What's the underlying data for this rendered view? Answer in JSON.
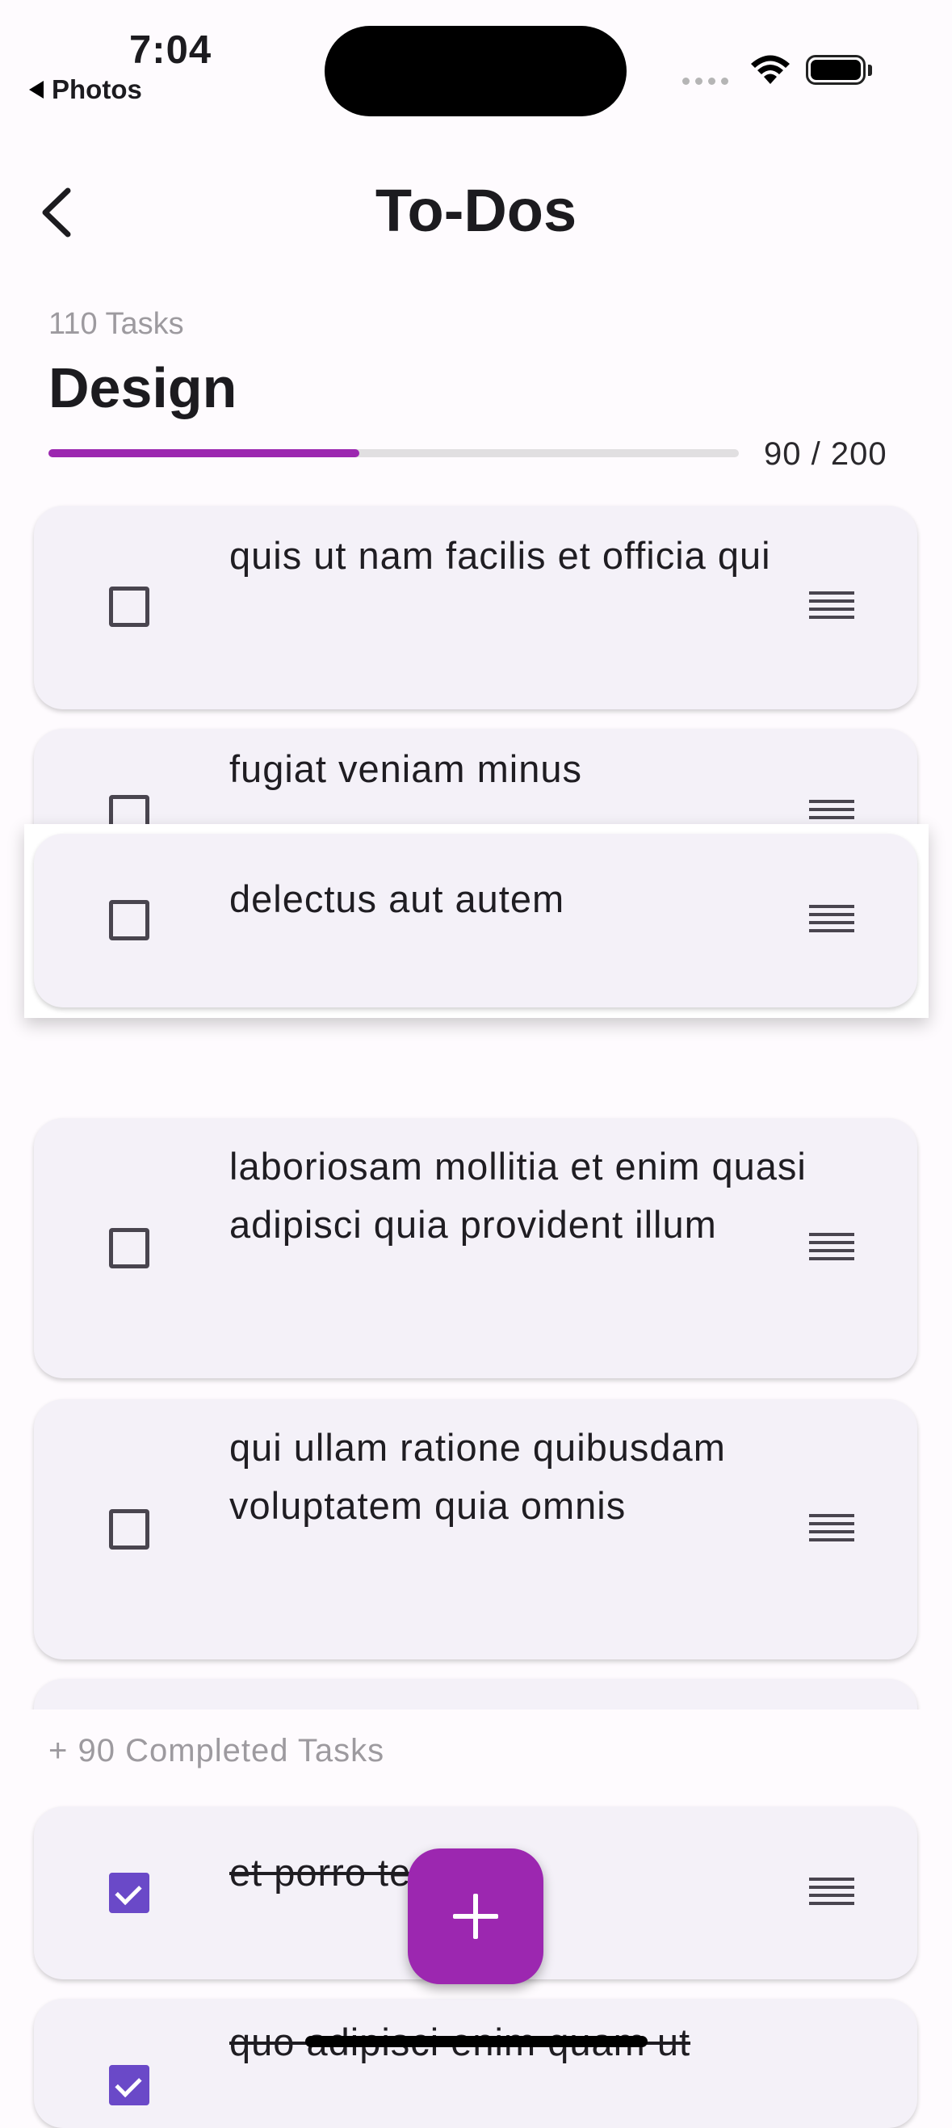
{
  "status_bar": {
    "time": "7:04",
    "back_app": "Photos"
  },
  "header": {
    "title": "To-Dos"
  },
  "project": {
    "task_count": "110 Tasks",
    "name": "Design",
    "progress_label": "90 / 200",
    "progress_fraction": 0.45,
    "accent": "#9c27b0"
  },
  "tasks": [
    {
      "text": "quis ut nam facilis et officia qui",
      "done": false
    },
    {
      "text": "fugiat veniam minus",
      "done": false
    },
    {
      "text": "delectus aut autem",
      "done": false
    },
    {
      "text": "laboriosam mollitia et enim quasi adipisci quia provident illum",
      "done": false
    },
    {
      "text": "qui ullam ratione quibusdam voluptatem quia omnis",
      "done": false
    }
  ],
  "completed": {
    "label": "+ 90 Completed Tasks",
    "items": [
      {
        "text": "et porro tempora",
        "done": true
      },
      {
        "text": "quo adipisci enim quam ut",
        "done": true
      }
    ]
  },
  "icons": {
    "back": "chevron-left-icon",
    "handle": "drag-handle-icon",
    "fab": "plus-icon"
  }
}
